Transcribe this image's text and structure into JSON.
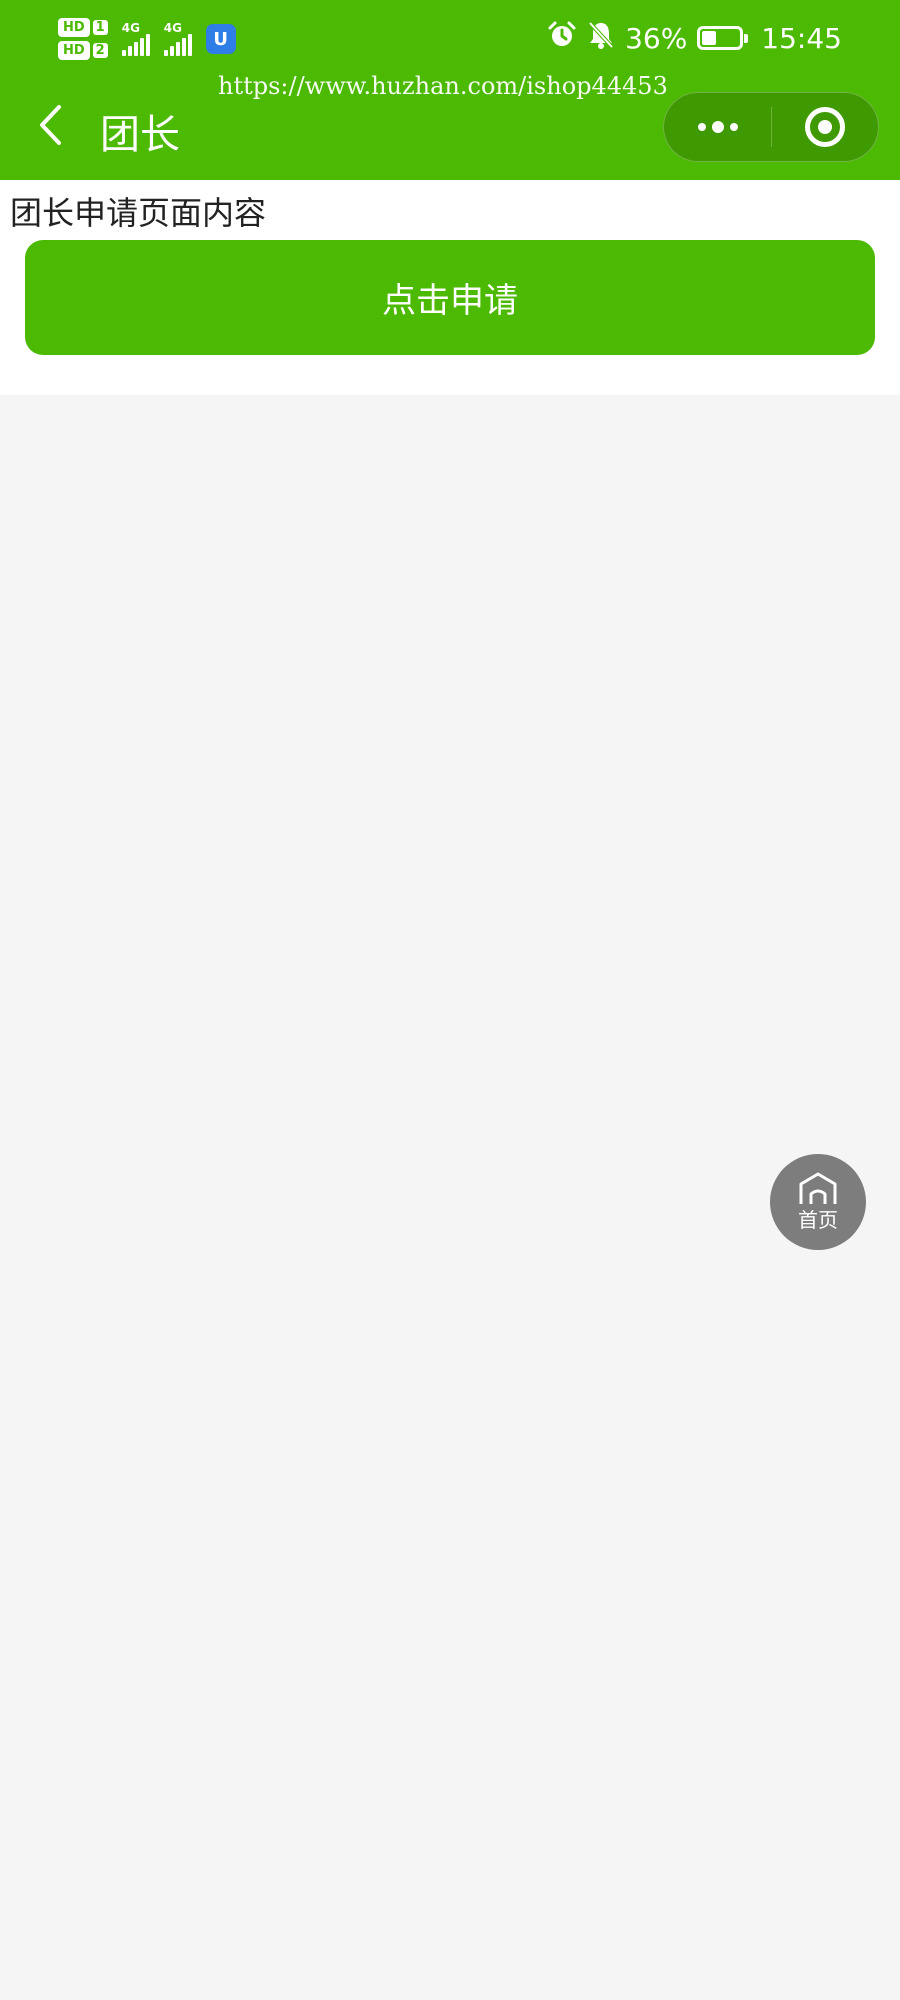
{
  "status_bar": {
    "hd1": "HD",
    "sim1": "1",
    "hd2": "HD",
    "sim2": "2",
    "net1": "4G",
    "net2": "4G",
    "app_icon_letter": "U",
    "battery_percent": "36%",
    "battery_level": 0.36,
    "time": "15:45"
  },
  "watermark": "https://www.huzhan.com/ishop44453",
  "navbar": {
    "title": "团长",
    "background_color": "#4cb903"
  },
  "content": {
    "text": "团长申请页面内容",
    "apply_button_label": "点击申请"
  },
  "home_fab": {
    "label": "首页"
  }
}
